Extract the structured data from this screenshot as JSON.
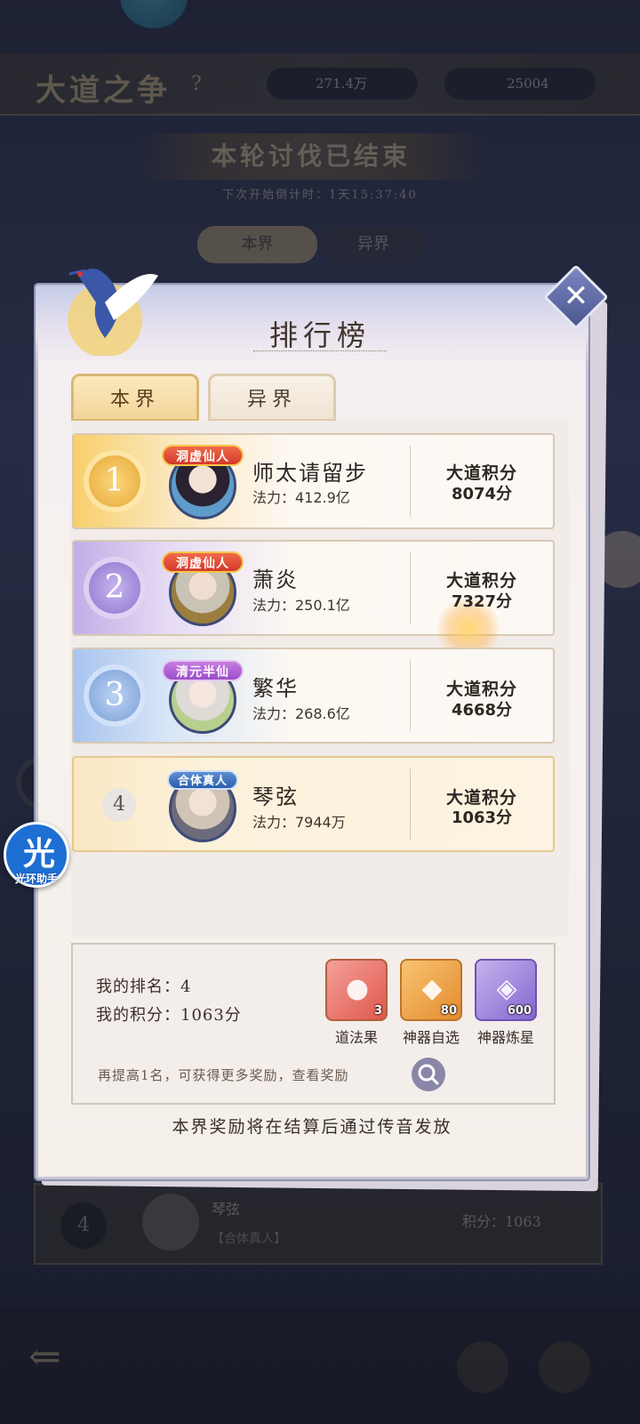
{
  "background": {
    "title": "大道之争",
    "help_icon": "question-icon",
    "resource_1": "271.4万",
    "resource_2": "25004",
    "banner": "本轮讨伐已结束",
    "countdown": "下次开始倒计时：1天15:37:40",
    "tabs": [
      "本界",
      "异界"
    ],
    "bottom_row": {
      "rank": "4",
      "name": "琴弦",
      "title": "【合体真人】",
      "score": "积分：1063"
    }
  },
  "modal": {
    "title": "排行榜",
    "close_icon": "close-icon",
    "tabs": [
      {
        "label": "本界",
        "active": true
      },
      {
        "label": "异界",
        "active": false
      }
    ],
    "rows": [
      {
        "rank": "1",
        "title": "洞虚仙人",
        "name": "师太请留步",
        "power": "法力：412.9亿",
        "score_label": "大道积分",
        "score": "8074分"
      },
      {
        "rank": "2",
        "title": "洞虚仙人",
        "name": "萧炎",
        "power": "法力：250.1亿",
        "score_label": "大道积分",
        "score": "7327分"
      },
      {
        "rank": "3",
        "title": "清元半仙",
        "name": "繁华",
        "power": "法力：268.6亿",
        "score_label": "大道积分",
        "score": "4668分"
      },
      {
        "rank": "4",
        "title": "合体真人",
        "name": "琴弦",
        "power": "法力：7944万",
        "score_label": "大道积分",
        "score": "1063分"
      }
    ],
    "my": {
      "rank": "我的排名：4",
      "score": "我的积分：1063分",
      "rewards": [
        {
          "name": "道法果",
          "count": "3",
          "icon": "peach-icon"
        },
        {
          "name": "神器自选",
          "count": "80",
          "icon": "artifact-chest-icon"
        },
        {
          "name": "神器炼星",
          "count": "600",
          "icon": "star-crystal-icon"
        }
      ],
      "hint": "再提高1名，可获得更多奖励，查看奖励",
      "search_icon": "search-icon"
    },
    "footer_note": "本界奖励将在结算后通过传音发放"
  },
  "assistant": {
    "glyph": "光",
    "label": "光环助手"
  },
  "colors": {
    "gold": "#f3d59a",
    "purple": "#c1aee6",
    "blue": "#a8c4ef",
    "modal_bg": "#f7f2ee"
  }
}
